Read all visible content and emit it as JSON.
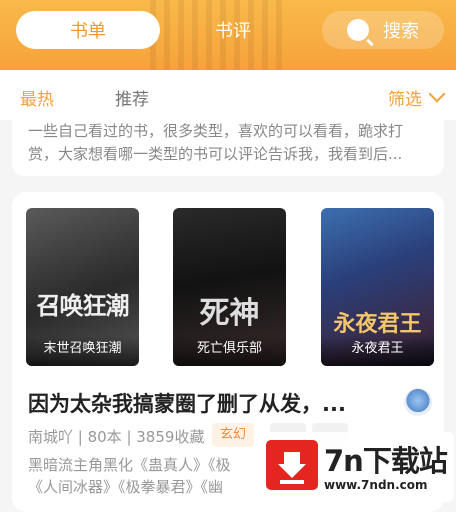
{
  "header": {
    "tabs": [
      "书单",
      "书评"
    ],
    "search_label": "搜索"
  },
  "filters": {
    "hot": "最热",
    "recommend": "推荐",
    "screen": "筛选"
  },
  "intro": {
    "text": "一些自己看过的书，很多类型，喜欢的可以看看，跪求打赏，大家想看哪一类型的书可以评论告诉我，我看到后..."
  },
  "booklist": {
    "covers": [
      {
        "title": "末世召唤狂潮",
        "art": "召唤狂潮"
      },
      {
        "title": "死亡俱乐部",
        "art": "死神"
      },
      {
        "title": "永夜君王",
        "art": "永夜君王"
      }
    ],
    "title": "因为太杂我搞蒙圈了删了从发，...",
    "meta": "南城吖 | 80本 | 3859收藏",
    "tag": "玄幻",
    "desc": "黑暗流主角黑化《蛊真人》《极 《人间冰器》《极拳暴君》《幽"
  },
  "watermark": {
    "name": "7n下载站",
    "url": "www.7ndn.com"
  }
}
